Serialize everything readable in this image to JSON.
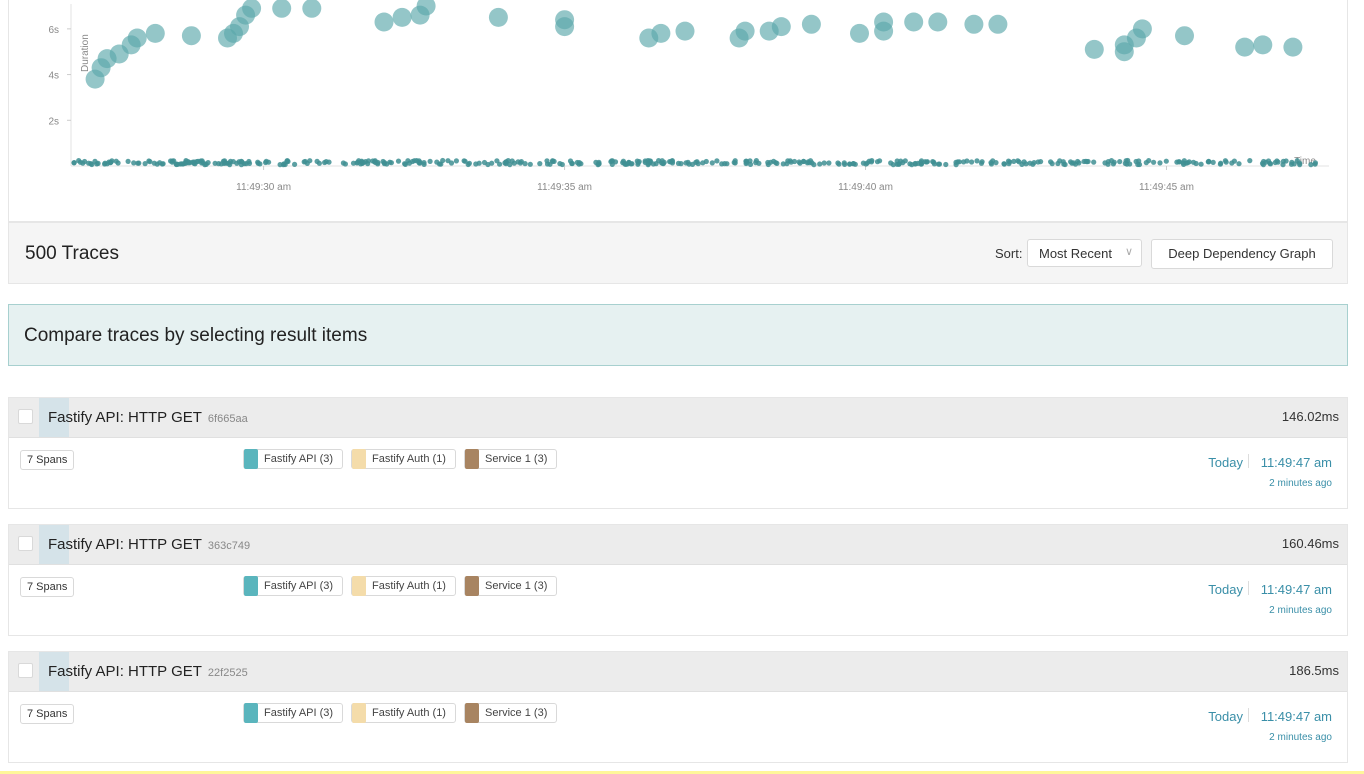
{
  "chart_data": {
    "type": "scatter",
    "ylabel": "Duration",
    "xlabel": "Time",
    "y_unit": "seconds",
    "yticks": [
      "2s",
      "4s",
      "6s"
    ],
    "xticks": [
      "11:49:30 am",
      "11:49:35 am",
      "11:49:40 am",
      "11:49:45 am"
    ],
    "x_tick_values_sec": [
      30,
      35,
      40,
      45
    ],
    "xlim_sec": [
      26.8,
      47.7
    ],
    "ylim_sec": [
      0,
      7
    ],
    "point_color": "#5aa8ab",
    "large_traces": [
      {
        "t": 27.2,
        "d": 3.8
      },
      {
        "t": 27.3,
        "d": 4.3
      },
      {
        "t": 27.4,
        "d": 4.7
      },
      {
        "t": 27.6,
        "d": 4.9
      },
      {
        "t": 27.8,
        "d": 5.3
      },
      {
        "t": 27.9,
        "d": 5.6
      },
      {
        "t": 28.2,
        "d": 5.8
      },
      {
        "t": 28.8,
        "d": 5.7
      },
      {
        "t": 29.4,
        "d": 5.6
      },
      {
        "t": 29.5,
        "d": 5.8
      },
      {
        "t": 29.6,
        "d": 6.1
      },
      {
        "t": 29.7,
        "d": 6.6
      },
      {
        "t": 29.8,
        "d": 6.9
      },
      {
        "t": 30.3,
        "d": 6.9
      },
      {
        "t": 30.8,
        "d": 6.9
      },
      {
        "t": 32.0,
        "d": 6.3
      },
      {
        "t": 32.3,
        "d": 6.5
      },
      {
        "t": 32.6,
        "d": 6.6
      },
      {
        "t": 32.7,
        "d": 7.0
      },
      {
        "t": 33.9,
        "d": 6.5
      },
      {
        "t": 35.0,
        "d": 6.1
      },
      {
        "t": 35.0,
        "d": 6.4
      },
      {
        "t": 36.4,
        "d": 5.6
      },
      {
        "t": 36.6,
        "d": 5.8
      },
      {
        "t": 37.0,
        "d": 5.9
      },
      {
        "t": 37.9,
        "d": 5.6
      },
      {
        "t": 38.0,
        "d": 5.9
      },
      {
        "t": 38.4,
        "d": 5.9
      },
      {
        "t": 38.6,
        "d": 6.1
      },
      {
        "t": 39.1,
        "d": 6.2
      },
      {
        "t": 39.9,
        "d": 5.8
      },
      {
        "t": 40.3,
        "d": 5.9
      },
      {
        "t": 40.3,
        "d": 6.3
      },
      {
        "t": 40.8,
        "d": 6.3
      },
      {
        "t": 41.2,
        "d": 6.3
      },
      {
        "t": 41.8,
        "d": 6.2
      },
      {
        "t": 42.2,
        "d": 6.2
      },
      {
        "t": 43.8,
        "d": 5.1
      },
      {
        "t": 44.3,
        "d": 5.0
      },
      {
        "t": 44.3,
        "d": 5.3
      },
      {
        "t": 44.5,
        "d": 5.6
      },
      {
        "t": 44.6,
        "d": 6.0
      },
      {
        "t": 45.3,
        "d": 5.7
      },
      {
        "t": 46.3,
        "d": 5.2
      },
      {
        "t": 46.6,
        "d": 5.3
      },
      {
        "t": 47.1,
        "d": 5.2
      }
    ],
    "small_trace_duration_sec": 0.15,
    "small_trace_count": 454
  },
  "results": {
    "title": "500 Traces",
    "sort_label": "Sort:",
    "sort_value": "Most Recent",
    "ddg_button": "Deep Dependency Graph"
  },
  "compare": {
    "text": "Compare traces by selecting result items"
  },
  "trace_colors": {
    "fastify_api": "#5ab5bd",
    "fastify_auth": "#f4dcaa",
    "service_1": "#a88461"
  },
  "traces": [
    {
      "title": "Fastify API: HTTP GET",
      "id": "6f665aa",
      "duration": "146.02ms",
      "spans": "7 Spans",
      "services": [
        "Fastify API (3)",
        "Fastify Auth (1)",
        "Service 1 (3)"
      ],
      "day": "Today",
      "time": "11:49:47 am",
      "ago": "2 minutes ago"
    },
    {
      "title": "Fastify API: HTTP GET",
      "id": "363c749",
      "duration": "160.46ms",
      "spans": "7 Spans",
      "services": [
        "Fastify API (3)",
        "Fastify Auth (1)",
        "Service 1 (3)"
      ],
      "day": "Today",
      "time": "11:49:47 am",
      "ago": "2 minutes ago"
    },
    {
      "title": "Fastify API: HTTP GET",
      "id": "22f2525",
      "duration": "186.5ms",
      "spans": "7 Spans",
      "services": [
        "Fastify API (3)",
        "Fastify Auth (1)",
        "Service 1 (3)"
      ],
      "day": "Today",
      "time": "11:49:47 am",
      "ago": "2 minutes ago"
    }
  ]
}
